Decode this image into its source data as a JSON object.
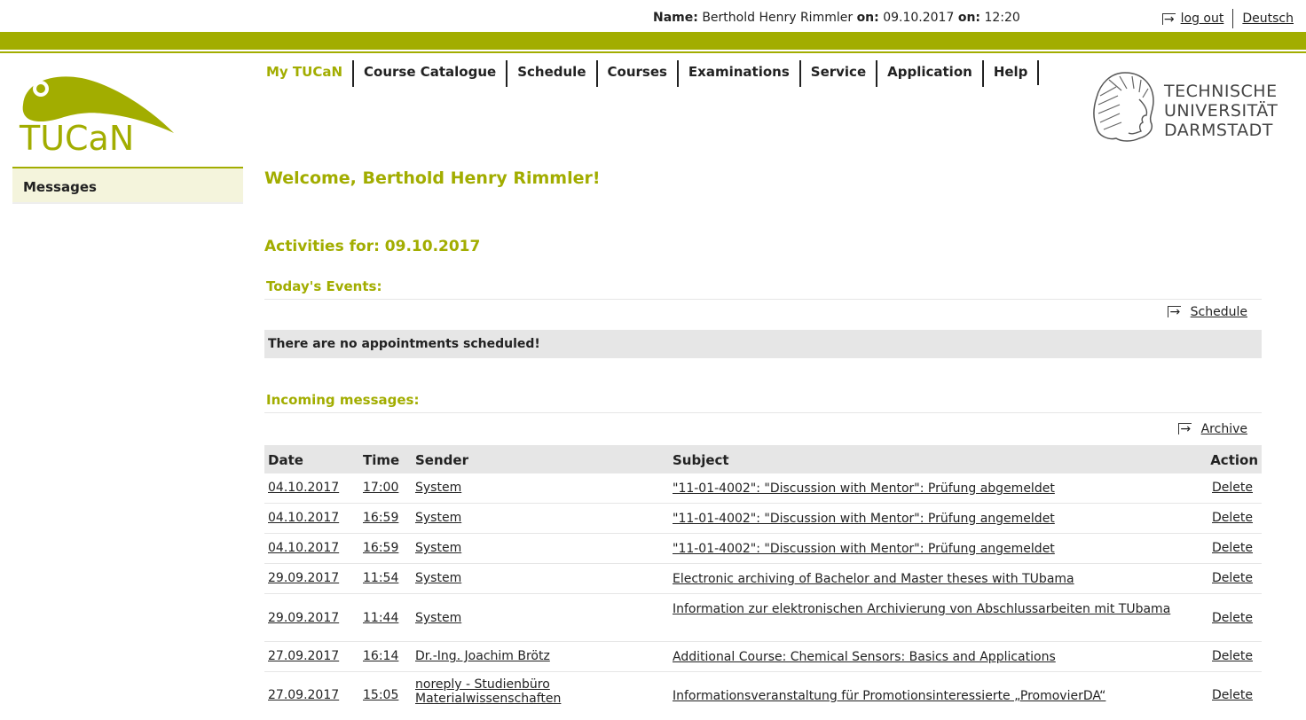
{
  "header": {
    "name_label": "Name:",
    "name_value": "Berthold Henry Rimmler",
    "on_label1": "on:",
    "date_value": "09.10.2017",
    "on_label2": "on:",
    "time_value": "12:20",
    "logout": "log out",
    "language": "Deutsch"
  },
  "logo": {
    "text": "TUCaN"
  },
  "nav": [
    "My TUCaN",
    "Course Catalogue",
    "Schedule",
    "Courses",
    "Examinations",
    "Service",
    "Application",
    "Help"
  ],
  "university": {
    "line1": "TECHNISCHE",
    "line2": "UNIVERSITÄT",
    "line3": "DARMSTADT"
  },
  "sidebar": {
    "items": [
      "Messages"
    ]
  },
  "main": {
    "welcome": "Welcome, Berthold Henry Rimmler!",
    "activities": "Activities for: 09.10.2017",
    "today_heading": "Today's Events:",
    "schedule_link": "Schedule",
    "no_appointments": "There are no appointments scheduled!",
    "messages_heading": "Incoming messages:",
    "archive_link": "Archive"
  },
  "table": {
    "headers": {
      "date": "Date",
      "time": "Time",
      "sender": "Sender",
      "subject": "Subject",
      "action": "Action"
    },
    "rows": [
      {
        "date": "04.10.2017",
        "time": "17:00",
        "sender": "System",
        "subject": "\"11-01-4002\": \"Discussion with Mentor\": Prüfung abgemeldet",
        "action": "Delete"
      },
      {
        "date": "04.10.2017",
        "time": "16:59",
        "sender": "System",
        "subject": "\"11-01-4002\": \"Discussion with Mentor\": Prüfung angemeldet",
        "action": "Delete"
      },
      {
        "date": "04.10.2017",
        "time": "16:59",
        "sender": "System",
        "subject": "\"11-01-4002\": \"Discussion with Mentor\": Prüfung angemeldet",
        "action": "Delete"
      },
      {
        "date": "29.09.2017",
        "time": "11:54",
        "sender": "System",
        "subject": "Electronic archiving of Bachelor and Master theses with TUbama",
        "action": "Delete"
      },
      {
        "date": "29.09.2017",
        "time": "11:44",
        "sender": "System",
        "subject": "Information zur elektronischen Archivierung von Abschlussarbeiten mit TUbama",
        "action": "Delete"
      },
      {
        "date": "27.09.2017",
        "time": "16:14",
        "sender": "Dr.-Ing. Joachim Brötz",
        "subject": "Additional Course: Chemical Sensors: Basics and Applications",
        "action": "Delete"
      },
      {
        "date": "27.09.2017",
        "time": "15:05",
        "sender": "noreply - Studienbüro Materialwissenschaften",
        "subject": "Informationsveranstaltung für Promotionsinteressierte „PromovierDA“",
        "action": "Delete"
      }
    ]
  }
}
